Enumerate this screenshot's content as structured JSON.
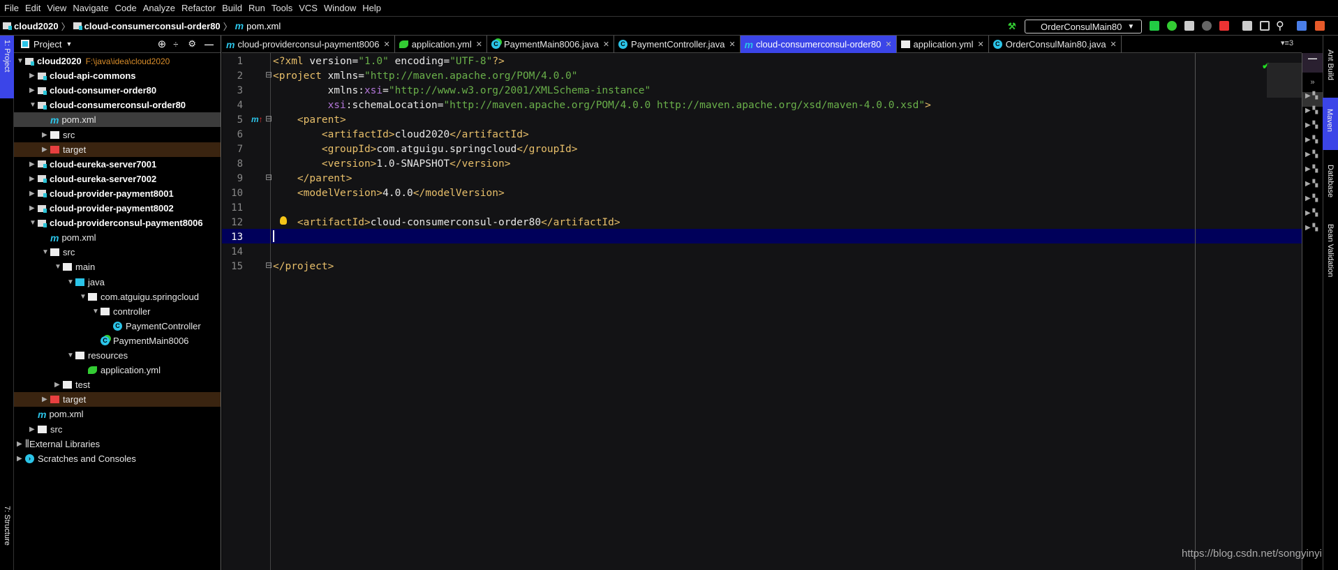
{
  "menu": [
    "File",
    "Edit",
    "View",
    "Navigate",
    "Code",
    "Analyze",
    "Refactor",
    "Build",
    "Run",
    "Tools",
    "VCS",
    "Window",
    "Help"
  ],
  "breadcrumb": [
    "cloud2020",
    "cloud-consumerconsul-order80",
    "pom.xml"
  ],
  "run_config": "OrderConsulMain80",
  "left_strip": {
    "project": "1: Project",
    "structure": "7: Structure"
  },
  "panel": {
    "title": "Project"
  },
  "tree": [
    {
      "label": "cloud2020",
      "path": "F:\\java\\idea\\cloud2020",
      "indent": 0,
      "arrow": "down",
      "icon": "module",
      "bold": true
    },
    {
      "label": "cloud-api-commons",
      "indent": 1,
      "arrow": "right",
      "icon": "module",
      "bold": true
    },
    {
      "label": "cloud-consumer-order80",
      "indent": 1,
      "arrow": "right",
      "icon": "module",
      "bold": true
    },
    {
      "label": "cloud-consumerconsul-order80",
      "indent": 1,
      "arrow": "down",
      "icon": "module",
      "bold": true
    },
    {
      "label": "pom.xml",
      "indent": 2,
      "arrow": "",
      "icon": "maven",
      "selected": true
    },
    {
      "label": "src",
      "indent": 2,
      "arrow": "right",
      "icon": "folder"
    },
    {
      "label": "target",
      "indent": 2,
      "arrow": "right",
      "icon": "excluded",
      "excluded": true
    },
    {
      "label": "cloud-eureka-server7001",
      "indent": 1,
      "arrow": "right",
      "icon": "module",
      "bold": true
    },
    {
      "label": "cloud-eureka-server7002",
      "indent": 1,
      "arrow": "right",
      "icon": "module",
      "bold": true
    },
    {
      "label": "cloud-provider-payment8001",
      "indent": 1,
      "arrow": "right",
      "icon": "module",
      "bold": true
    },
    {
      "label": "cloud-provider-payment8002",
      "indent": 1,
      "arrow": "right",
      "icon": "module",
      "bold": true
    },
    {
      "label": "cloud-providerconsul-payment8006",
      "indent": 1,
      "arrow": "down",
      "icon": "module",
      "bold": true
    },
    {
      "label": "pom.xml",
      "indent": 2,
      "arrow": "",
      "icon": "maven"
    },
    {
      "label": "src",
      "indent": 2,
      "arrow": "down",
      "icon": "folder"
    },
    {
      "label": "main",
      "indent": 3,
      "arrow": "down",
      "icon": "folder"
    },
    {
      "label": "java",
      "indent": 4,
      "arrow": "down",
      "icon": "source"
    },
    {
      "label": "com.atguigu.springcloud",
      "indent": 5,
      "arrow": "down",
      "icon": "package"
    },
    {
      "label": "controller",
      "indent": 6,
      "arrow": "down",
      "icon": "package"
    },
    {
      "label": "PaymentController",
      "indent": 7,
      "arrow": "",
      "icon": "class"
    },
    {
      "label": "PaymentMain8006",
      "indent": 6,
      "arrow": "",
      "icon": "spring-class"
    },
    {
      "label": "resources",
      "indent": 4,
      "arrow": "down",
      "icon": "resources"
    },
    {
      "label": "application.yml",
      "indent": 5,
      "arrow": "",
      "icon": "spring-yml"
    },
    {
      "label": "test",
      "indent": 3,
      "arrow": "right",
      "icon": "folder"
    },
    {
      "label": "target",
      "indent": 2,
      "arrow": "right",
      "icon": "excluded",
      "excluded": true
    },
    {
      "label": "pom.xml",
      "indent": 1,
      "arrow": "",
      "icon": "maven"
    },
    {
      "label": "src",
      "indent": 1,
      "arrow": "right",
      "icon": "folder"
    },
    {
      "label": "External Libraries",
      "indent": 0,
      "arrow": "right",
      "icon": "libraries"
    },
    {
      "label": "Scratches and Consoles",
      "indent": 0,
      "arrow": "right",
      "icon": "scratches"
    }
  ],
  "tabs": [
    {
      "label": "cloud-providerconsul-payment8006",
      "icon": "maven"
    },
    {
      "label": "application.yml",
      "icon": "spring-yml"
    },
    {
      "label": "PaymentMain8006.java",
      "icon": "spring-class"
    },
    {
      "label": "PaymentController.java",
      "icon": "class"
    },
    {
      "label": "cloud-consumerconsul-order80",
      "icon": "maven",
      "active": true
    },
    {
      "label": "application.yml",
      "icon": "yml"
    },
    {
      "label": "OrderConsulMain80.java",
      "icon": "class"
    }
  ],
  "tab_overflow": "3",
  "code_lines": [
    [
      [
        "t",
        "<?xml "
      ],
      [
        "",
        "version="
      ],
      [
        "s",
        "\"1.0\""
      ],
      [
        "",
        " encoding="
      ],
      [
        "s",
        "\"UTF-8\""
      ],
      [
        "t",
        "?>"
      ]
    ],
    [
      [
        "t",
        "<project "
      ],
      [
        "",
        "xmlns="
      ],
      [
        "s",
        "\"http://maven.apache.org/POM/4.0.0\""
      ]
    ],
    [
      [
        "",
        "         xmlns:"
      ],
      [
        "p",
        "xsi"
      ],
      [
        "",
        "="
      ],
      [
        "s",
        "\"http://www.w3.org/2001/XMLSchema-instance\""
      ]
    ],
    [
      [
        "p",
        "         xsi"
      ],
      [
        "",
        ":schemaLocation="
      ],
      [
        "s",
        "\"http://maven.apache.org/POM/4.0.0 http://maven.apache.org/xsd/maven-4.0.0.xsd\""
      ],
      [
        "t",
        ">"
      ]
    ],
    [
      [
        "t",
        "    <parent>"
      ]
    ],
    [
      [
        "t",
        "        <artifactId>"
      ],
      [
        "",
        "cloud2020"
      ],
      [
        "t",
        "</artifactId>"
      ]
    ],
    [
      [
        "t",
        "        <groupId>"
      ],
      [
        "",
        "com.atguigu.springcloud"
      ],
      [
        "t",
        "</groupId>"
      ]
    ],
    [
      [
        "t",
        "        <version>"
      ],
      [
        "",
        "1.0-SNAPSHOT"
      ],
      [
        "t",
        "</version>"
      ]
    ],
    [
      [
        "t",
        "    </parent>"
      ]
    ],
    [
      [
        "t",
        "    <modelVersion>"
      ],
      [
        "",
        "4.0.0"
      ],
      [
        "t",
        "</modelVersion>"
      ]
    ],
    [],
    [
      [
        "t",
        "    <artifactId>"
      ],
      [
        "",
        "cloud-consumerconsul-order80"
      ],
      [
        "t",
        "</artifactId>"
      ]
    ],
    [],
    [],
    [
      [
        "t",
        "</project>"
      ]
    ]
  ],
  "current_line": 13,
  "right_strip": [
    "Ant Build",
    "Maven",
    "Database",
    "Bean Validation"
  ],
  "watermark": "https://blog.csdn.net/songyinyi",
  "colors": {
    "accent": "#3b45e8",
    "tag": "#e8bf6a",
    "string": "#6ab04a",
    "namespace": "#b276d8",
    "current_line": "#00005a"
  }
}
